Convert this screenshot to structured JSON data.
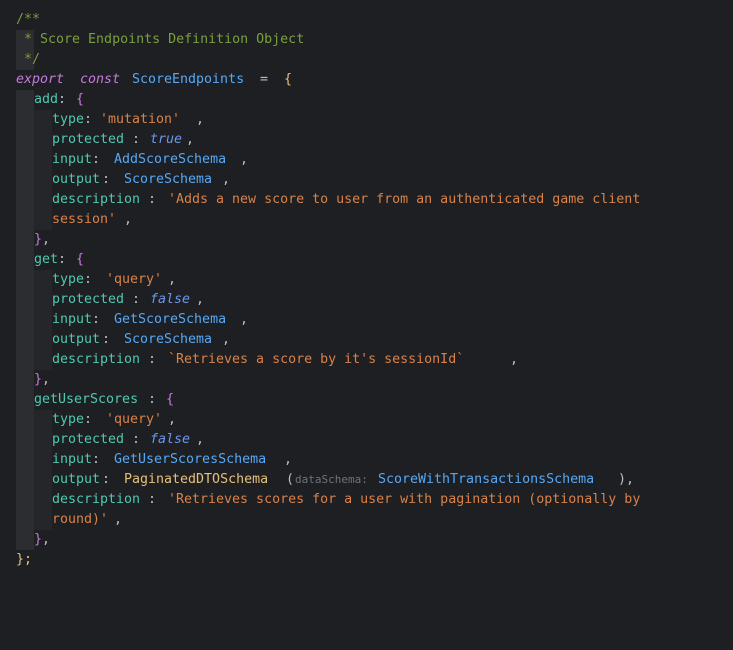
{
  "lines": {
    "l1": "/**",
    "l2": " * Score Endpoints Definition Object",
    "l3": " */",
    "l4_export": "export",
    "l4_const": "const",
    "l4_name": "ScoreEndpoints",
    "l4_eq": " = ",
    "l4_brace": "{",
    "l5_key": "add",
    "l5_brace": "{",
    "l6_key": "type",
    "l6_val": "'mutation'",
    "l7_key": "protected",
    "l7_val": "true",
    "l8_key": "input",
    "l8_val": "AddScoreSchema",
    "l9_key": "output",
    "l9_val": "ScoreSchema",
    "l10_key": "description",
    "l10_val": "'Adds a new score to user from an authenticated game client",
    "l11_val": "session'",
    "l12_brace": "}",
    "l13_key": "get",
    "l13_brace": "{",
    "l14_key": "type",
    "l14_val": "'query'",
    "l15_key": "protected",
    "l15_val": "false",
    "l16_key": "input",
    "l16_val": "GetScoreSchema",
    "l17_key": "output",
    "l17_val": "ScoreSchema",
    "l18_key": "description",
    "l18_val": "`Retrieves a score by it's sessionId`",
    "l19_brace": "}",
    "l20_key": "getUserScores",
    "l20_brace": "{",
    "l21_key": "type",
    "l21_val": "'query'",
    "l22_key": "protected",
    "l22_val": "false",
    "l23_key": "input",
    "l23_val": "GetUserScoresSchema",
    "l24_key": "output",
    "l24_fn": "PaginatedDTOSchema",
    "l24_hint": "dataSchema:",
    "l24_arg": "ScoreWithTransactionsSchema",
    "l25_key": "description",
    "l25_val": "'Retrieves scores for a user with pagination (optionally by",
    "l26_val": "round)'",
    "l27_brace": "}",
    "l28_brace": "};"
  },
  "colors": {
    "background": "#1e1f22",
    "comment": "#7a9f3d",
    "keyword": "#c679dd",
    "identifier": "#56a8f5",
    "property": "#4ec9b0",
    "string": "#d9824a",
    "boolean": "#6c95eb",
    "brace": "#e5c07b",
    "hint": "#6f737a"
  }
}
